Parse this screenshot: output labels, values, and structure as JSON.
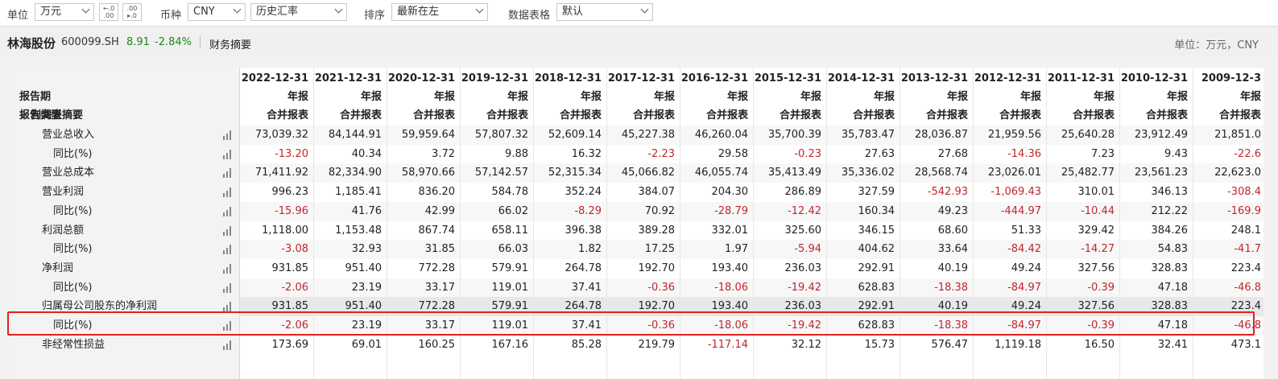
{
  "toolbar": {
    "unit_label": "单位",
    "unit_value": "万元",
    "decimal_increase": "+.0\n.00",
    "decimal_decrease": ".00\n►.0",
    "currency_label": "币种",
    "currency_value": "CNY",
    "rate_value": "历史汇率",
    "sort_label": "排序",
    "sort_value": "最新在左",
    "table_label": "数据表格",
    "table_value": "默认"
  },
  "header": {
    "company": "林海股份",
    "code": "600099.SH",
    "price": "8.91",
    "change": "-2.84%",
    "summary": "财务摘要",
    "unit": "单位：万元，CNY"
  },
  "table": {
    "row_labels": {
      "period": "报告期",
      "type": "报告类型",
      "section": "利润表摘要"
    },
    "columns": [
      {
        "date": "2022-12-31",
        "kind": "年报",
        "stmt": "合并报表"
      },
      {
        "date": "2021-12-31",
        "kind": "年报",
        "stmt": "合并报表"
      },
      {
        "date": "2020-12-31",
        "kind": "年报",
        "stmt": "合并报表"
      },
      {
        "date": "2019-12-31",
        "kind": "年报",
        "stmt": "合并报表"
      },
      {
        "date": "2018-12-31",
        "kind": "年报",
        "stmt": "合并报表"
      },
      {
        "date": "2017-12-31",
        "kind": "年报",
        "stmt": "合并报表"
      },
      {
        "date": "2016-12-31",
        "kind": "年报",
        "stmt": "合并报表"
      },
      {
        "date": "2015-12-31",
        "kind": "年报",
        "stmt": "合并报表"
      },
      {
        "date": "2014-12-31",
        "kind": "年报",
        "stmt": "合并报表"
      },
      {
        "date": "2013-12-31",
        "kind": "年报",
        "stmt": "合并报表"
      },
      {
        "date": "2012-12-31",
        "kind": "年报",
        "stmt": "合并报表"
      },
      {
        "date": "2011-12-31",
        "kind": "年报",
        "stmt": "合并报表"
      },
      {
        "date": "2010-12-31",
        "kind": "年报",
        "stmt": "合并报表"
      },
      {
        "date": "2009-12-3",
        "kind": "年报",
        "stmt": "合并报表"
      }
    ],
    "rows": [
      {
        "label": "营业总收入",
        "indent": 1,
        "values": [
          "73,039.32",
          "84,144.91",
          "59,959.64",
          "57,807.32",
          "52,609.14",
          "45,227.38",
          "46,260.04",
          "35,700.39",
          "35,783.47",
          "28,036.87",
          "21,959.56",
          "25,640.28",
          "23,912.49",
          "21,851.0"
        ]
      },
      {
        "label": "同比(%)",
        "indent": 2,
        "values": [
          "-13.20",
          "40.34",
          "3.72",
          "9.88",
          "16.32",
          "-2.23",
          "29.58",
          "-0.23",
          "27.63",
          "27.68",
          "-14.36",
          "7.23",
          "9.43",
          "-22.6"
        ]
      },
      {
        "label": "营业总成本",
        "indent": 1,
        "values": [
          "71,411.92",
          "82,334.90",
          "58,970.66",
          "57,142.57",
          "52,315.34",
          "45,066.82",
          "46,055.74",
          "35,413.49",
          "35,336.02",
          "28,568.74",
          "23,026.01",
          "25,482.77",
          "23,561.23",
          "22,623.0"
        ]
      },
      {
        "label": "营业利润",
        "indent": 1,
        "values": [
          "996.23",
          "1,185.41",
          "836.20",
          "584.78",
          "352.24",
          "384.07",
          "204.30",
          "286.89",
          "327.59",
          "-542.93",
          "-1,069.43",
          "310.01",
          "346.13",
          "-308.4"
        ]
      },
      {
        "label": "同比(%)",
        "indent": 2,
        "values": [
          "-15.96",
          "41.76",
          "42.99",
          "66.02",
          "-8.29",
          "70.92",
          "-28.79",
          "-12.42",
          "160.34",
          "49.23",
          "-444.97",
          "-10.44",
          "212.22",
          "-169.9"
        ]
      },
      {
        "label": "利润总额",
        "indent": 1,
        "values": [
          "1,118.00",
          "1,153.48",
          "867.74",
          "658.11",
          "396.38",
          "389.28",
          "332.01",
          "325.60",
          "346.15",
          "68.60",
          "51.33",
          "329.42",
          "384.26",
          "248.1"
        ]
      },
      {
        "label": "同比(%)",
        "indent": 2,
        "values": [
          "-3.08",
          "32.93",
          "31.85",
          "66.03",
          "1.82",
          "17.25",
          "1.97",
          "-5.94",
          "404.62",
          "33.64",
          "-84.42",
          "-14.27",
          "54.83",
          "-41.7"
        ]
      },
      {
        "label": "净利润",
        "indent": 1,
        "values": [
          "931.85",
          "951.40",
          "772.28",
          "579.91",
          "264.78",
          "192.70",
          "193.40",
          "236.03",
          "292.91",
          "40.19",
          "49.24",
          "327.56",
          "328.83",
          "223.4"
        ]
      },
      {
        "label": "同比(%)",
        "indent": 2,
        "values": [
          "-2.06",
          "23.19",
          "33.17",
          "119.01",
          "37.41",
          "-0.36",
          "-18.06",
          "-19.42",
          "628.83",
          "-18.38",
          "-84.97",
          "-0.39",
          "47.18",
          "-46.8"
        ]
      },
      {
        "label": "归属母公司股东的净利润",
        "indent": 1,
        "values": [
          "931.85",
          "951.40",
          "772.28",
          "579.91",
          "264.78",
          "192.70",
          "193.40",
          "236.03",
          "292.91",
          "40.19",
          "49.24",
          "327.56",
          "328.83",
          "223.4"
        ]
      },
      {
        "label": "同比(%)",
        "indent": 2,
        "values": [
          "-2.06",
          "23.19",
          "33.17",
          "119.01",
          "37.41",
          "-0.36",
          "-18.06",
          "-19.42",
          "628.83",
          "-18.38",
          "-84.97",
          "-0.39",
          "47.18",
          "-46.8"
        ]
      },
      {
        "label": "非经常性损益",
        "indent": 1,
        "values": [
          "173.69",
          "69.01",
          "160.25",
          "167.16",
          "85.28",
          "219.79",
          "-117.14",
          "32.12",
          "15.73",
          "576.47",
          "1,119.18",
          "16.50",
          "32.41",
          "473.1"
        ]
      }
    ],
    "highlighted_row_index": 9
  },
  "colors": {
    "negative": "#c0262c",
    "positive_change": "#1a8a1a",
    "highlight_border": "#e0221f"
  }
}
